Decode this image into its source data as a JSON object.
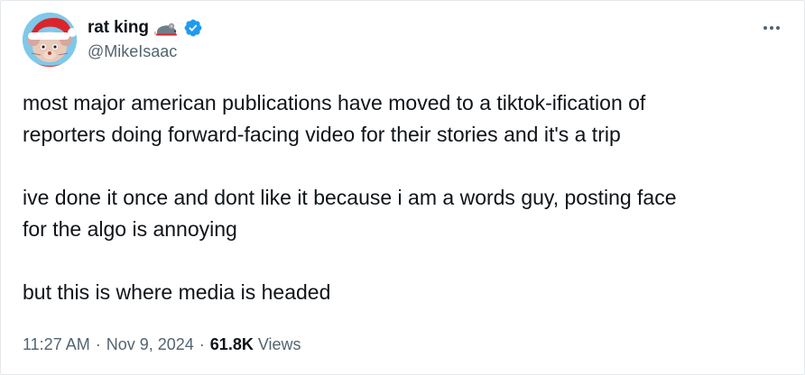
{
  "author": {
    "display_name": "rat king",
    "name_emoji": "rat-emoji",
    "verified_badge": "verified-check-icon",
    "handle": "@MikeIsaac",
    "avatar": "avatar-icon"
  },
  "menu": {
    "more_icon": "more-dots-icon"
  },
  "tweet": {
    "paragraphs": [
      "most major american publications have moved to a tiktok-ification of\nreporters doing forward-facing video for their stories and it's a trip",
      "ive done it once and dont like it because i am a words guy, posting face\nfor the algo is annoying",
      "but this is where media is headed"
    ]
  },
  "meta": {
    "time": "11:27 AM",
    "separator": "·",
    "date": "Nov 9, 2024",
    "views_count": "61.8K",
    "views_label": "Views"
  },
  "colors": {
    "text_primary": "#0f1419",
    "text_secondary": "#536471",
    "verified_blue": "#1d9bf0",
    "border": "#e6e9ec"
  }
}
